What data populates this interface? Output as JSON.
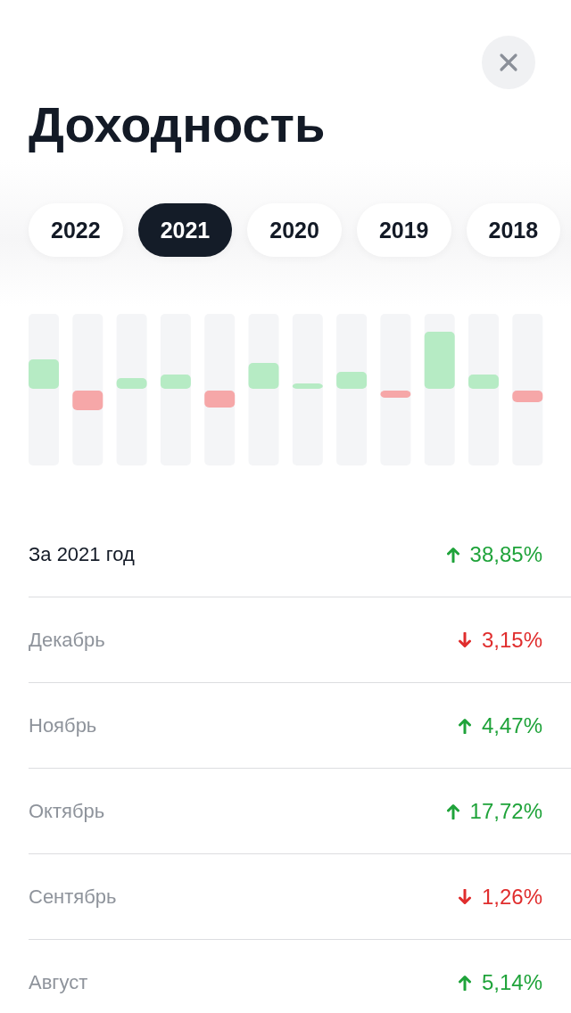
{
  "title": "Доходность",
  "years": [
    {
      "label": "2022",
      "selected": false
    },
    {
      "label": "2021",
      "selected": true
    },
    {
      "label": "2020",
      "selected": false
    },
    {
      "label": "2019",
      "selected": false
    },
    {
      "label": "2018",
      "selected": false
    }
  ],
  "rows": [
    {
      "kind": "total",
      "label": "За 2021 год",
      "rising": true,
      "value": "38,85%"
    },
    {
      "kind": "month",
      "label": "Декабрь",
      "rising": false,
      "value": "3,15%"
    },
    {
      "kind": "month",
      "label": "Ноябрь",
      "rising": true,
      "value": "4,47%"
    },
    {
      "kind": "month",
      "label": "Октябрь",
      "rising": true,
      "value": "17,72%"
    },
    {
      "kind": "month",
      "label": "Сентябрь",
      "rising": false,
      "value": "1,26%"
    },
    {
      "kind": "month",
      "label": "Август",
      "rising": true,
      "value": "5,14%"
    }
  ]
}
